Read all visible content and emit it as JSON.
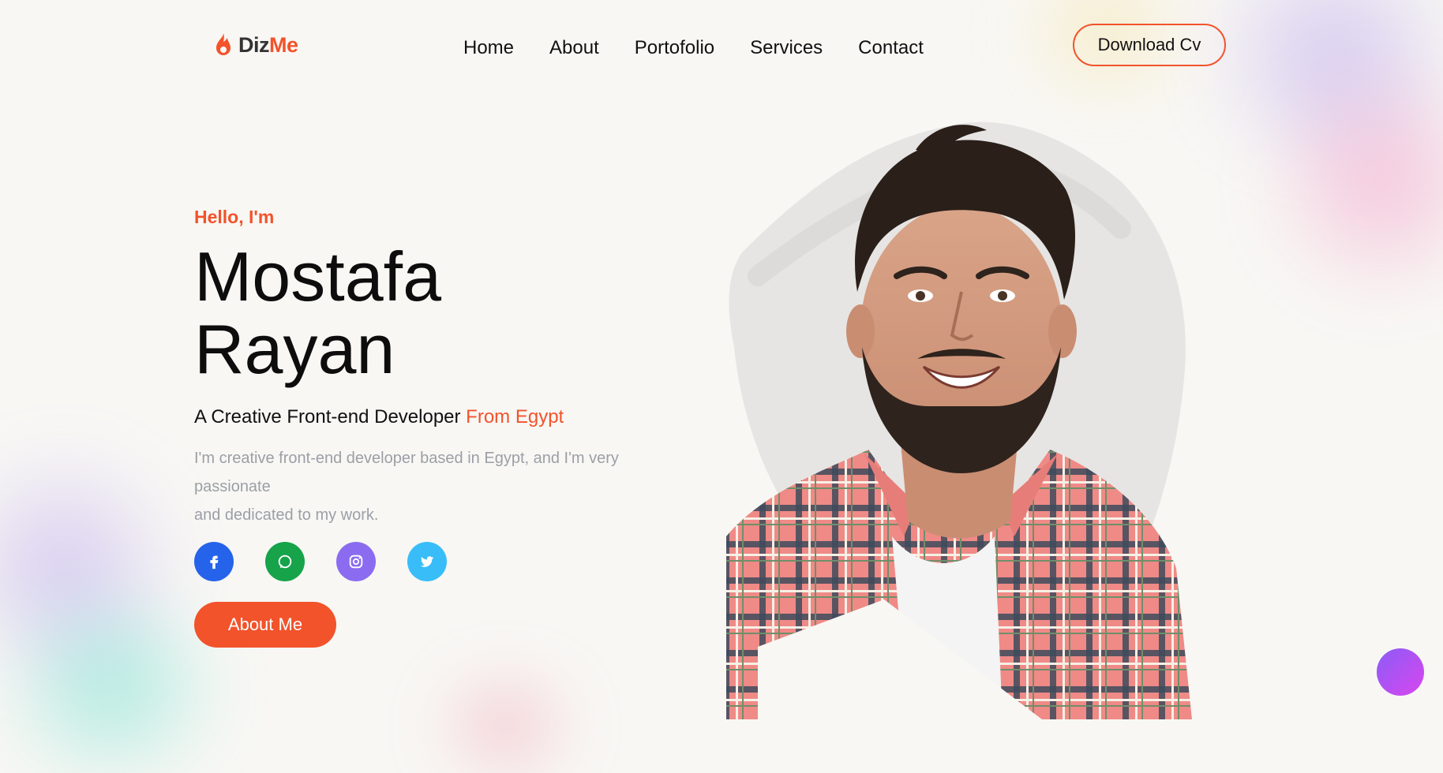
{
  "brand": {
    "name_part1": "Diz",
    "name_part2": "Me",
    "accent": "#f2532b"
  },
  "nav": {
    "items": [
      {
        "label": "Home"
      },
      {
        "label": "About"
      },
      {
        "label": "Portofolio"
      },
      {
        "label": "Services"
      },
      {
        "label": "Contact"
      }
    ],
    "cta_label": "Download Cv"
  },
  "hero": {
    "greeting": "Hello, I'm",
    "first_name": "Mostafa",
    "last_name": "Rayan",
    "tagline_main": "A Creative Front-end Developer",
    "tagline_highlight": "From Egypt",
    "description_line1": "I'm creative front-end developer based in Egypt, and I'm very passionate",
    "description_line2": "and dedicated to my work.",
    "socials": [
      {
        "icon": "facebook-icon",
        "color": "#2563eb"
      },
      {
        "icon": "whatsapp-icon",
        "color": "#16a34a"
      },
      {
        "icon": "instagram-icon",
        "color": "#8b6cf0"
      },
      {
        "icon": "twitter-icon",
        "color": "#38bdf8"
      }
    ],
    "button_label": "About Me"
  },
  "floating_button": {
    "icon": "chat-icon",
    "color": "#b14cf0"
  }
}
